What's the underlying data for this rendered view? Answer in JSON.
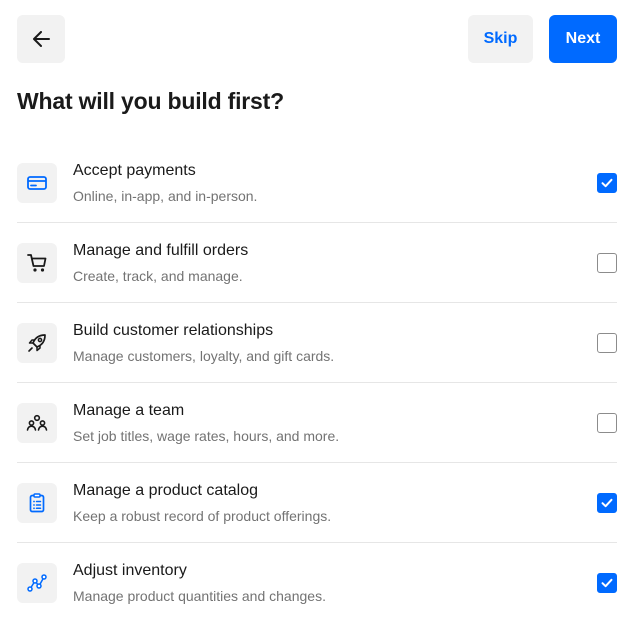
{
  "header": {
    "skip_label": "Skip",
    "next_label": "Next",
    "back_icon": "arrow-left-icon"
  },
  "title": "What will you build first?",
  "accent_color": "#006aff",
  "options": [
    {
      "title": "Accept payments",
      "subtitle": "Online, in-app, and in-person.",
      "icon": "credit-card-icon",
      "checked": true
    },
    {
      "title": "Manage and fulfill orders",
      "subtitle": "Create, track, and manage.",
      "icon": "cart-icon",
      "checked": false
    },
    {
      "title": "Build customer relationships",
      "subtitle": "Manage customers, loyalty, and gift cards.",
      "icon": "rocket-icon",
      "checked": false
    },
    {
      "title": "Manage a team",
      "subtitle": "Set job titles, wage rates, hours, and more.",
      "icon": "team-icon",
      "checked": false
    },
    {
      "title": "Manage a product catalog",
      "subtitle": "Keep a robust record of product offerings.",
      "icon": "clipboard-icon",
      "checked": true
    },
    {
      "title": "Adjust inventory",
      "subtitle": "Manage product quantities and changes.",
      "icon": "line-graph-icon",
      "checked": true
    }
  ]
}
